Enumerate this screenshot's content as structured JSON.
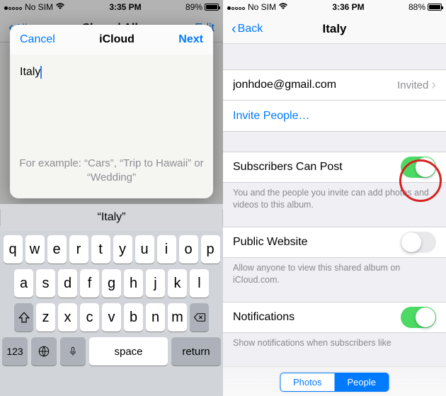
{
  "left": {
    "status": {
      "carrier": "No SIM",
      "wifi": true,
      "time": "3:35 PM",
      "battery_pct": "89%",
      "battery_fill": 0.89
    },
    "nav": {
      "back_label": "Albums",
      "title": "Shared Albums",
      "right_label": "Edit"
    },
    "sheet": {
      "cancel": "Cancel",
      "title": "iCloud",
      "next": "Next",
      "input_value": "Italy",
      "example": "For example: “Cars”, “Trip to Hawaii” or “Wedding”"
    },
    "suggestion": "“Italy”",
    "keyboard": {
      "rows": [
        [
          "q",
          "w",
          "e",
          "r",
          "t",
          "y",
          "u",
          "i",
          "o",
          "p"
        ],
        [
          "a",
          "s",
          "d",
          "f",
          "g",
          "h",
          "j",
          "k",
          "l"
        ],
        [
          "z",
          "x",
          "c",
          "v",
          "b",
          "n",
          "m"
        ]
      ],
      "numkey": "123",
      "space": "space",
      "return": "return"
    }
  },
  "right": {
    "status": {
      "carrier": "No SIM",
      "wifi": true,
      "time": "3:36 PM",
      "battery_pct": "88%",
      "battery_fill": 0.88
    },
    "nav": {
      "back_label": "Back",
      "title": "Italy"
    },
    "invitee": {
      "email": "jonhdoe@gmail.com",
      "status": "Invited"
    },
    "invite_label": "Invite People…",
    "subscribers": {
      "label": "Subscribers Can Post",
      "on": true,
      "note": "You and the people you invite can add photos and videos to this album."
    },
    "public_site": {
      "label": "Public Website",
      "on": false,
      "note": "Allow anyone to view this shared album on iCloud.com."
    },
    "notifications": {
      "label": "Notifications",
      "on": true,
      "note": "Show notifications when subscribers like"
    },
    "seg": {
      "photos": "Photos",
      "people": "People"
    }
  }
}
